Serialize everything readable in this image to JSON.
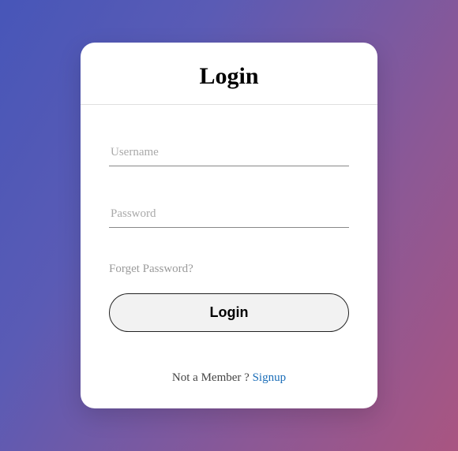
{
  "header": {
    "title": "Login"
  },
  "form": {
    "username_placeholder": "Username",
    "password_placeholder": "Password",
    "forgot_text": "Forget Password?",
    "submit_label": "Login"
  },
  "footer": {
    "not_member_text": "Not a Member ? ",
    "signup_label": "Signup"
  }
}
